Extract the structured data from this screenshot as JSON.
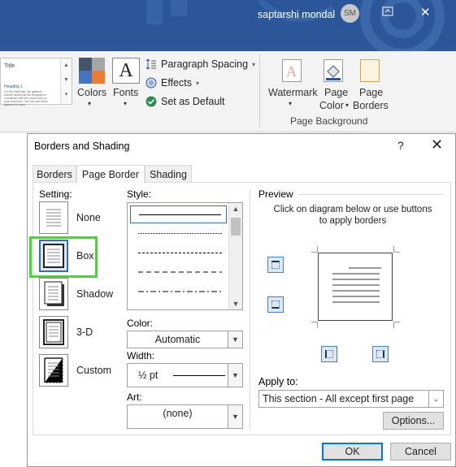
{
  "titlebar": {
    "user_name": "saptarshi mondal",
    "avatar_initials": "SM",
    "ribbon_display_icon": "ribbon-display-options-icon",
    "close_icon": "close-icon"
  },
  "ribbon": {
    "styles_gallery": {
      "title": "Title",
      "heading": "Heading 1",
      "preview_text": "On the Insert tab, the galleries include items that are designed to coordinate with the overall look of your document. You can use these galleries to insert"
    },
    "colors_label": "Colors",
    "fonts_label": "Fonts",
    "fonts_glyph": "A",
    "paragraph_spacing_label": "Paragraph Spacing",
    "effects_label": "Effects",
    "set_as_default_label": "Set as Default",
    "watermark_label": "Watermark",
    "page_color_label_1": "Page",
    "page_color_label_2": "Color",
    "page_borders_label_1": "Page",
    "page_borders_label_2": "Borders",
    "group_label": "Page Background",
    "colors": {
      "accent": "#2b579a",
      "swatch_1": "#44546a",
      "swatch_2": "#4472c4",
      "swatch_3": "#ed7d31",
      "swatch_4": "#a5a5a5"
    }
  },
  "dialog": {
    "title": "Borders and Shading",
    "help": "?",
    "close": "✕",
    "tabs": [
      "Borders",
      "Page Border",
      "Shading"
    ],
    "active_tab": "Page Border",
    "setting_label": "Setting:",
    "settings": [
      {
        "label": "None",
        "icon": "border-none-icon"
      },
      {
        "label": "Box",
        "icon": "border-box-icon",
        "selected": true
      },
      {
        "label": "Shadow",
        "icon": "border-shadow-icon"
      },
      {
        "label": "3-D",
        "icon": "border-3d-icon"
      },
      {
        "label": "Custom",
        "icon": "border-custom-icon"
      }
    ],
    "style_label": "Style:",
    "styles": [
      "solid",
      "dotted",
      "dashed-small",
      "dashed-large",
      "dash-dot"
    ],
    "color_label": "Color:",
    "color_value": "Automatic",
    "width_label": "Width:",
    "width_value": "½ pt",
    "art_label": "Art:",
    "art_value": "(none)",
    "preview_label": "Preview",
    "preview_hint": "Click on diagram below or use buttons to apply borders",
    "apply_to_label": "Apply to:",
    "apply_to_value": "This section - All except first page",
    "options_button": "Options...",
    "ok_button": "OK",
    "cancel_button": "Cancel",
    "highlight_color": "#3ddd2a"
  }
}
